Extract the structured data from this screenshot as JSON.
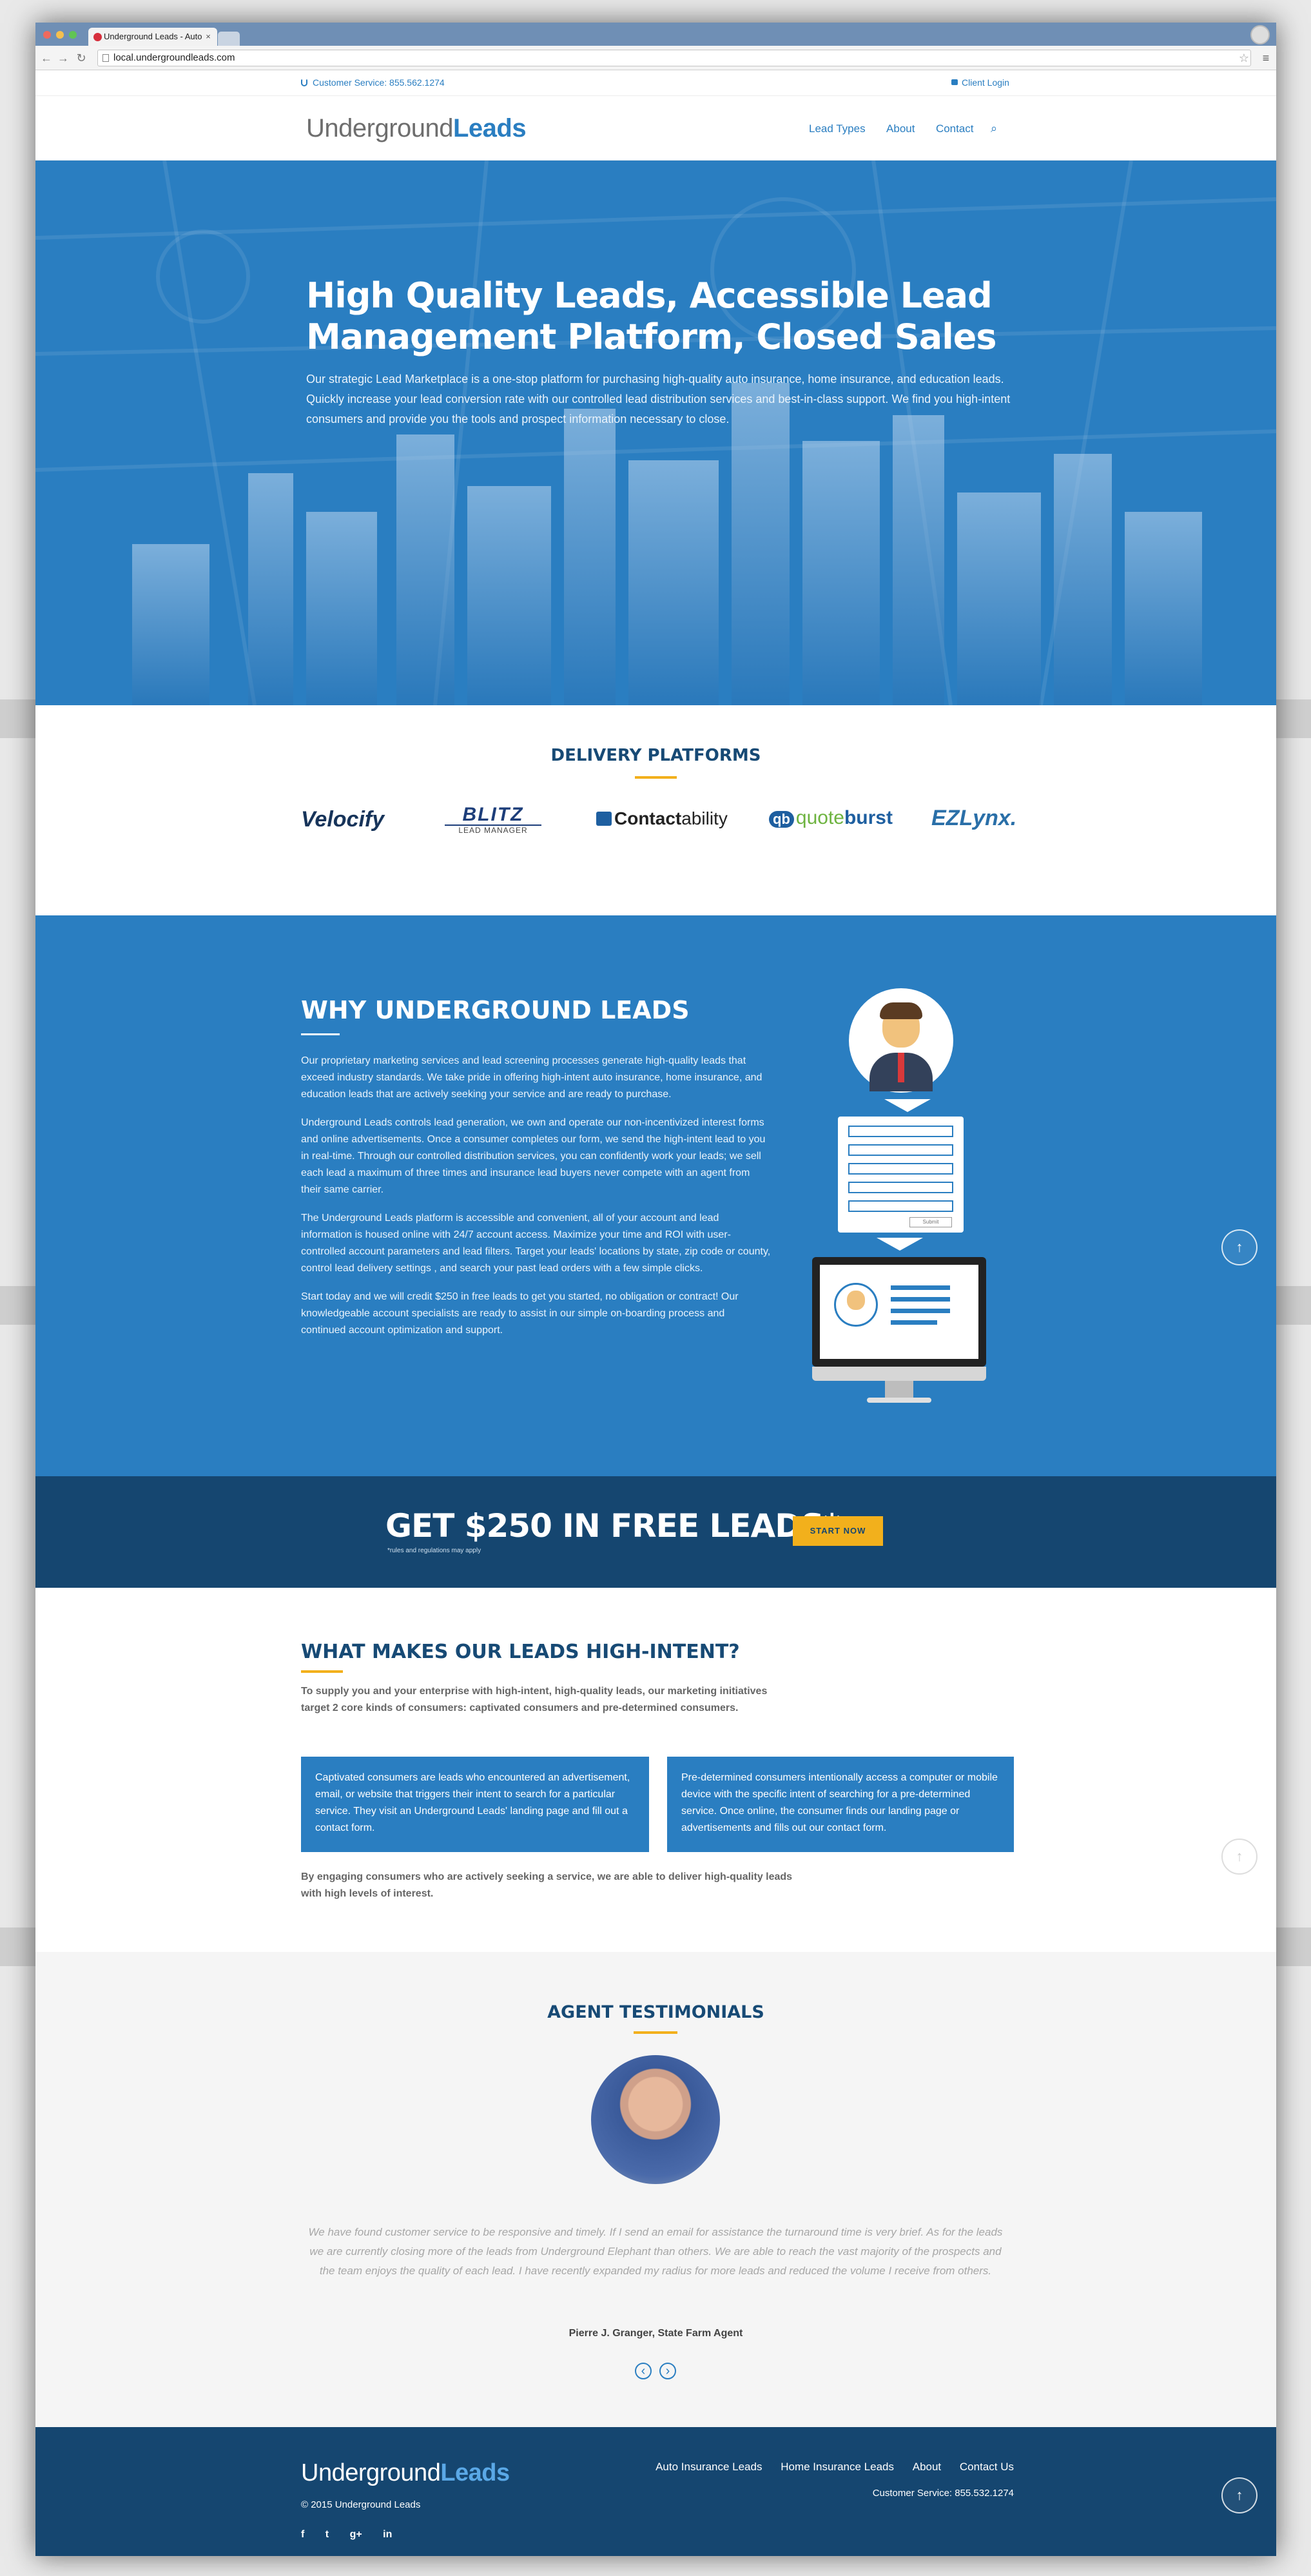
{
  "browser": {
    "tab_title": "Underground Leads - Auto",
    "tab_close": "×",
    "url": "local.undergroundleads.com",
    "back_glyph": "←",
    "forward_glyph": "→",
    "reload_glyph": "↻",
    "star_glyph": "☆",
    "menu_glyph": "≡",
    "icons": {
      "favicon": "underground-leads-favicon",
      "back": "back-arrow-icon",
      "forward": "forward-arrow-icon",
      "reload": "reload-icon",
      "star": "bookmark-star-icon",
      "menu": "hamburger-menu-icon"
    }
  },
  "topbar": {
    "customer_service": "Customer Service: 855.562.1274",
    "client_login": "Client Login",
    "icons": {
      "phone": "phone-icon",
      "lock": "lock-icon"
    }
  },
  "header": {
    "logo_light": "Underground",
    "logo_bold": "Leads",
    "nav": [
      "Lead Types",
      "About",
      "Contact"
    ],
    "search_glyph": "⌕",
    "colors": {
      "brand_blue": "#2a7ec1",
      "navy": "#154670",
      "accent": "#f2b01c"
    }
  },
  "hero": {
    "title_line1": "High Quality Leads, Accessible Lead",
    "title_line2": "Management Platform, Closed Sales",
    "body": "Our strategic Lead Marketplace is a one-stop platform for purchasing high-quality auto insurance, home insurance, and education leads. Quickly increase your lead conversion rate with our controlled lead distribution services and best-in-class support. We find you high-intent consumers and provide you the tools and prospect information necessary to close."
  },
  "delivery": {
    "heading": "DELIVERY PLATFORMS",
    "partners": {
      "velocify": "Velocify",
      "blitz": "BLITZ",
      "blitz_sub": "LEAD MANAGER",
      "contact_bold": "Contact",
      "contact_light": "ability",
      "qb_badge": "qb",
      "quote_light": "quote",
      "quote_bold": "burst",
      "ezlynx": "EZLynx."
    }
  },
  "why": {
    "heading": "WHY UNDERGROUND LEADS",
    "paragraphs": [
      "Our proprietary marketing services and lead screening processes generate high-quality leads that exceed industry standards. We take pride in offering high-intent auto insurance, home insurance, and education leads that are actively seeking your service and are ready to purchase.",
      "Underground Leads controls lead generation, we own and operate our non-incentivized interest forms and online advertisements. Once a consumer completes our form, we send the high-intent lead to you in real-time. Through our controlled distribution services, you can confidently work your leads; we sell each lead a maximum of three times and insurance lead buyers never compete with an agent from their same carrier.",
      "The Underground Leads platform is accessible and convenient, all of your account and lead information is housed online with 24/7 account access. Maximize your time and ROI with user-controlled account parameters and lead filters. Target your leads' locations by state, zip code or county, control lead delivery settings , and search your past lead orders with a few simple clicks.",
      "Start today and we will credit $250 in free leads to get you started, no obligation or contract! Our knowledgeable account specialists are ready to assist in our simple on-boarding process and continued account optimization and support."
    ],
    "form_submit": "Submit"
  },
  "promo": {
    "headline": "GET $250 IN FREE LEADS*",
    "fineprint": "*rules and regulations may apply",
    "cta": "START NOW"
  },
  "intent": {
    "heading": "WHAT MAKES OUR LEADS HIGH-INTENT?",
    "intro": "To supply you and your enterprise with high-intent, high-quality leads, our marketing initiatives target 2 core kinds of consumers: captivated consumers and pre-determined consumers.",
    "box_left": "Captivated consumers are leads who encountered an advertisement, email, or website that triggers their intent to search for a particular service. They visit an Underground Leads' landing page and fill out a contact form.",
    "box_right": "Pre-determined consumers intentionally access a computer or mobile device with the specific intent of searching for a pre-determined service. Once online, the consumer finds our landing page or advertisements and fills out our contact form.",
    "outro": "By engaging consumers who are actively seeking a service, we are able to deliver high-quality leads with high levels of interest."
  },
  "testimonials": {
    "heading": "AGENT TESTIMONIALS",
    "quote": "We have found customer service to be responsive and timely. If I send an email for assistance the turnaround time is very brief. As for the leads we are currently closing more of the leads from Underground Elephant than others. We are able to reach the vast majority of the prospects and the team enjoys the quality of each lead. I have recently expanded my radius for more leads and reduced the volume I receive from others.",
    "author": "Pierre J. Granger, State Farm Agent",
    "prev_glyph": "‹",
    "next_glyph": "›"
  },
  "footer": {
    "logo_light": "Underground",
    "logo_bold": "Leads",
    "copyright": "© 2015 Underground Leads",
    "links": [
      "Auto Insurance Leads",
      "Home Insurance Leads",
      "About",
      "Contact Us"
    ],
    "customer_service": "Customer Service: 855.532.1274",
    "social": [
      "f",
      "t",
      "g+",
      "in"
    ],
    "social_icons": [
      "facebook-icon",
      "twitter-icon",
      "google-plus-icon",
      "linkedin-icon"
    ]
  },
  "scroll_top_glyph": "↑"
}
